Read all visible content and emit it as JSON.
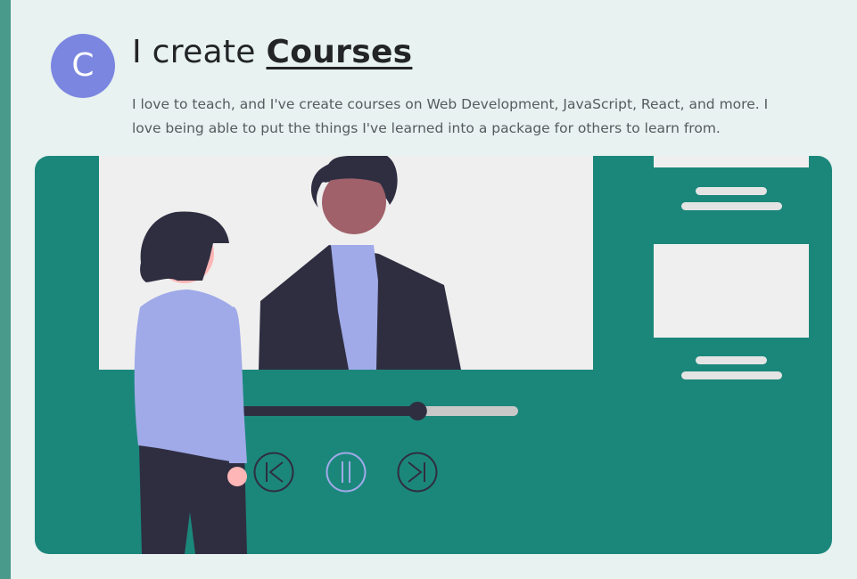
{
  "section": {
    "badge_letter": "C",
    "heading_prefix": "I create",
    "heading_emphasis": "Courses",
    "description": "I love to teach, and I've create courses on Web Development, JavaScript, React, and more. I love being able to put the things I've learned into a package for others to learn from."
  },
  "illustration": {
    "playback_progress": 0.65,
    "icons": [
      "previous-icon",
      "pause-icon",
      "next-icon"
    ]
  },
  "colors": {
    "accent_bar": "#4a9a8c",
    "badge": "#7b86e0",
    "teal": "#1b877b",
    "screen": "#efefef",
    "dark": "#2f2e41",
    "lavender": "#a0aae8",
    "skin_dark": "#a0616a",
    "skin_light": "#ffb6b6"
  }
}
